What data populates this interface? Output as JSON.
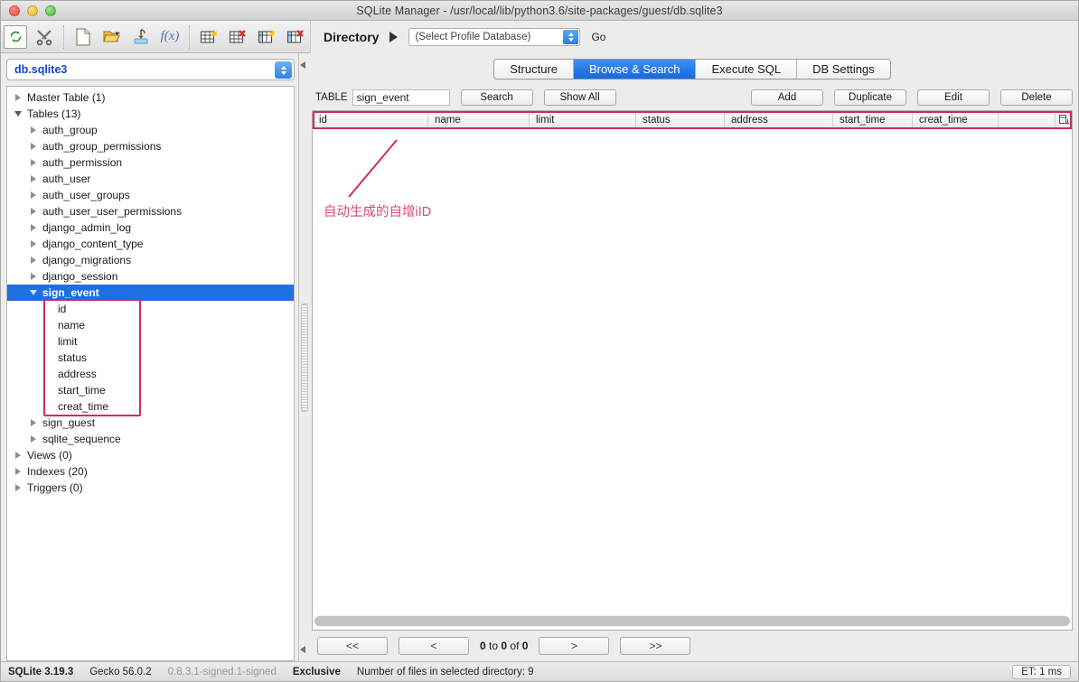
{
  "window": {
    "title": "SQLite Manager - /usr/local/lib/python3.6/site-packages/guest/db.sqlite3"
  },
  "toolbar": {
    "icons": [
      {
        "name": "refresh-icon",
        "label": "Refresh"
      },
      {
        "name": "tools-icon",
        "label": "Tools"
      },
      {
        "name": "new-database-icon",
        "label": "New Database"
      },
      {
        "name": "open-database-icon",
        "label": "Open Database"
      },
      {
        "name": "import-icon",
        "label": "Import"
      },
      {
        "name": "function-icon",
        "label": "f(x)"
      },
      {
        "name": "create-table-icon",
        "label": "Create Table"
      },
      {
        "name": "drop-table-icon",
        "label": "Drop Table"
      },
      {
        "name": "create-index-icon",
        "label": "Create Index"
      },
      {
        "name": "drop-index-icon",
        "label": "Drop Index"
      }
    ],
    "directory_label": "Directory",
    "profile_database": "(Select Profile Database)",
    "go_label": "Go"
  },
  "sidebar": {
    "database_name": "db.sqlite3",
    "tree": [
      {
        "label": "Master Table (1)",
        "depth": 0,
        "state": "collapsed",
        "selected": false
      },
      {
        "label": "Tables (13)",
        "depth": 0,
        "state": "expanded",
        "selected": false
      },
      {
        "label": "auth_group",
        "depth": 1,
        "state": "collapsed",
        "selected": false
      },
      {
        "label": "auth_group_permissions",
        "depth": 1,
        "state": "collapsed",
        "selected": false
      },
      {
        "label": "auth_permission",
        "depth": 1,
        "state": "collapsed",
        "selected": false
      },
      {
        "label": "auth_user",
        "depth": 1,
        "state": "collapsed",
        "selected": false
      },
      {
        "label": "auth_user_groups",
        "depth": 1,
        "state": "collapsed",
        "selected": false
      },
      {
        "label": "auth_user_user_permissions",
        "depth": 1,
        "state": "collapsed",
        "selected": false
      },
      {
        "label": "django_admin_log",
        "depth": 1,
        "state": "collapsed",
        "selected": false
      },
      {
        "label": "django_content_type",
        "depth": 1,
        "state": "collapsed",
        "selected": false
      },
      {
        "label": "django_migrations",
        "depth": 1,
        "state": "collapsed",
        "selected": false
      },
      {
        "label": "django_session",
        "depth": 1,
        "state": "collapsed",
        "selected": false
      },
      {
        "label": "sign_event",
        "depth": 1,
        "state": "expanded",
        "selected": true
      },
      {
        "label": "id",
        "depth": 2,
        "state": "leaf",
        "selected": false
      },
      {
        "label": "name",
        "depth": 2,
        "state": "leaf",
        "selected": false
      },
      {
        "label": "limit",
        "depth": 2,
        "state": "leaf",
        "selected": false
      },
      {
        "label": "status",
        "depth": 2,
        "state": "leaf",
        "selected": false
      },
      {
        "label": "address",
        "depth": 2,
        "state": "leaf",
        "selected": false
      },
      {
        "label": "start_time",
        "depth": 2,
        "state": "leaf",
        "selected": false
      },
      {
        "label": "creat_time",
        "depth": 2,
        "state": "leaf",
        "selected": false
      },
      {
        "label": "sign_guest",
        "depth": 1,
        "state": "collapsed",
        "selected": false
      },
      {
        "label": "sqlite_sequence",
        "depth": 1,
        "state": "collapsed",
        "selected": false
      },
      {
        "label": "Views (0)",
        "depth": 0,
        "state": "collapsed",
        "selected": false
      },
      {
        "label": "Indexes (20)",
        "depth": 0,
        "state": "collapsed",
        "selected": false
      },
      {
        "label": "Triggers (0)",
        "depth": 0,
        "state": "collapsed",
        "selected": false
      }
    ]
  },
  "tabs": [
    {
      "label": "Structure",
      "active": false
    },
    {
      "label": "Browse & Search",
      "active": true
    },
    {
      "label": "Execute SQL",
      "active": false
    },
    {
      "label": "DB Settings",
      "active": false
    }
  ],
  "actionbar": {
    "table_label": "TABLE",
    "table_name": "sign_event",
    "search_label": "Search",
    "show_all_label": "Show All",
    "add_label": "Add",
    "duplicate_label": "Duplicate",
    "edit_label": "Edit",
    "delete_label": "Delete"
  },
  "grid": {
    "columns": [
      "id",
      "name",
      "limit",
      "status",
      "address",
      "start_time",
      "creat_time"
    ],
    "rows": []
  },
  "annotations": {
    "id_note": "自动生成的自增iID",
    "color": "#cf2a63"
  },
  "pager": {
    "first_label": "<<",
    "prev_label": "<",
    "from": "0",
    "to_label": "to",
    "to": "0",
    "of_label": "of",
    "total": "0",
    "next_label": ">",
    "last_label": ">>"
  },
  "statusbar": {
    "sqlite_version": "SQLite 3.19.3",
    "gecko_version": "Gecko 56.0.2",
    "extension_version": "0.8.3.1-signed.1-signed",
    "lock_mode": "Exclusive",
    "file_count": "Number of files in selected directory: 9",
    "elapsed": "ET: 1 ms"
  }
}
